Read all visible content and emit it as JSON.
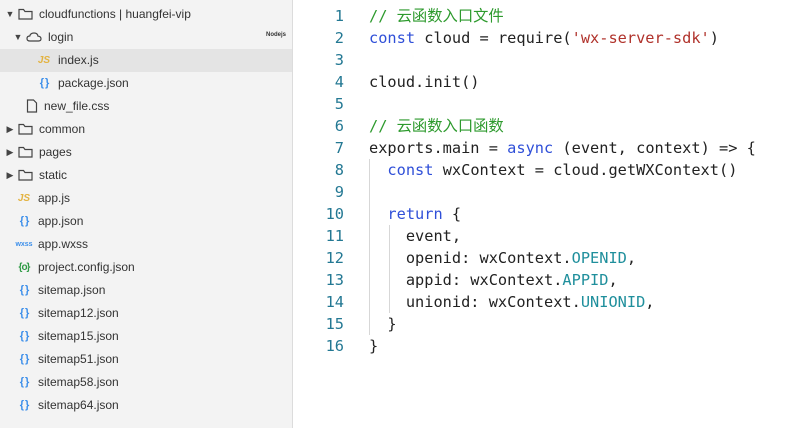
{
  "explorer": {
    "items": [
      {
        "label": "cloudfunctions | huangfei-vip",
        "icon": "folder-open-icon",
        "twisty": "▼",
        "indent": 0
      },
      {
        "label": "login",
        "icon": "cloud-icon",
        "twisty": "▼",
        "indent": 1,
        "badge": "Nodejs"
      },
      {
        "label": "index.js",
        "icon": "js-icon",
        "glyph": "JS",
        "indent": 3,
        "selected": true
      },
      {
        "label": "package.json",
        "icon": "json-icon",
        "glyph": "{ }",
        "indent": 3
      },
      {
        "label": "new_file.css",
        "icon": "file-icon",
        "indent": 2
      },
      {
        "label": "common",
        "icon": "folder-icon",
        "twisty": "▶",
        "indent": 0
      },
      {
        "label": "pages",
        "icon": "folder-icon",
        "twisty": "▶",
        "indent": 0
      },
      {
        "label": "static",
        "icon": "folder-icon",
        "twisty": "▶",
        "indent": 0
      },
      {
        "label": "app.js",
        "icon": "js-icon",
        "glyph": "JS",
        "indent": 1
      },
      {
        "label": "app.json",
        "icon": "json-icon",
        "glyph": "{ }",
        "indent": 1
      },
      {
        "label": "app.wxss",
        "icon": "wxss-icon",
        "glyph": "wxss",
        "indent": 1
      },
      {
        "label": "project.config.json",
        "icon": "config-icon",
        "glyph": "{o}",
        "indent": 1
      },
      {
        "label": "sitemap.json",
        "icon": "json-icon",
        "glyph": "{ }",
        "indent": 1
      },
      {
        "label": "sitemap12.json",
        "icon": "json-icon",
        "glyph": "{ }",
        "indent": 1
      },
      {
        "label": "sitemap15.json",
        "icon": "json-icon",
        "glyph": "{ }",
        "indent": 1
      },
      {
        "label": "sitemap51.json",
        "icon": "json-icon",
        "glyph": "{ }",
        "indent": 1
      },
      {
        "label": "sitemap58.json",
        "icon": "json-icon",
        "glyph": "{ }",
        "indent": 1
      },
      {
        "label": "sitemap64.json",
        "icon": "json-icon",
        "glyph": "{ }",
        "indent": 1
      }
    ]
  },
  "editor": {
    "lines": [
      {
        "n": "1",
        "tokens": [
          {
            "t": "// 云函数入口文件",
            "c": "comment"
          }
        ]
      },
      {
        "n": "2",
        "tokens": [
          {
            "t": "const",
            "c": "keyword"
          },
          {
            "t": " cloud = require("
          },
          {
            "t": "'wx-server-sdk'",
            "c": "string"
          },
          {
            "t": ")"
          }
        ]
      },
      {
        "n": "3",
        "tokens": []
      },
      {
        "n": "4",
        "tokens": [
          {
            "t": "cloud.init()"
          }
        ]
      },
      {
        "n": "5",
        "tokens": []
      },
      {
        "n": "6",
        "tokens": [
          {
            "t": "// 云函数入口函数",
            "c": "comment"
          }
        ]
      },
      {
        "n": "7",
        "tokens": [
          {
            "t": "exports.main = "
          },
          {
            "t": "async",
            "c": "keyword"
          },
          {
            "t": " (event, context) => {"
          }
        ]
      },
      {
        "n": "8",
        "tokens": [
          {
            "t": "  "
          },
          {
            "t": "const",
            "c": "keyword"
          },
          {
            "t": " wxContext = cloud.getWXContext()"
          }
        ]
      },
      {
        "n": "9",
        "tokens": []
      },
      {
        "n": "10",
        "tokens": [
          {
            "t": "  "
          },
          {
            "t": "return",
            "c": "keyword"
          },
          {
            "t": " {"
          }
        ]
      },
      {
        "n": "11",
        "tokens": [
          {
            "t": "    event,"
          }
        ]
      },
      {
        "n": "12",
        "tokens": [
          {
            "t": "    openid: wxContext."
          },
          {
            "t": "OPENID",
            "c": "const"
          },
          {
            "t": ","
          }
        ]
      },
      {
        "n": "13",
        "tokens": [
          {
            "t": "    appid: wxContext."
          },
          {
            "t": "APPID",
            "c": "const"
          },
          {
            "t": ","
          }
        ]
      },
      {
        "n": "14",
        "tokens": [
          {
            "t": "    unionid: wxContext."
          },
          {
            "t": "UNIONID",
            "c": "const"
          },
          {
            "t": ","
          }
        ]
      },
      {
        "n": "15",
        "tokens": [
          {
            "t": "  }"
          }
        ]
      },
      {
        "n": "16",
        "tokens": [
          {
            "t": "}"
          }
        ]
      }
    ]
  },
  "colors": {
    "comment": "#2d9a2d",
    "keyword": "#2f4fd8",
    "string": "#b0322b",
    "const": "#1f8f9c",
    "line_number": "#237893"
  }
}
